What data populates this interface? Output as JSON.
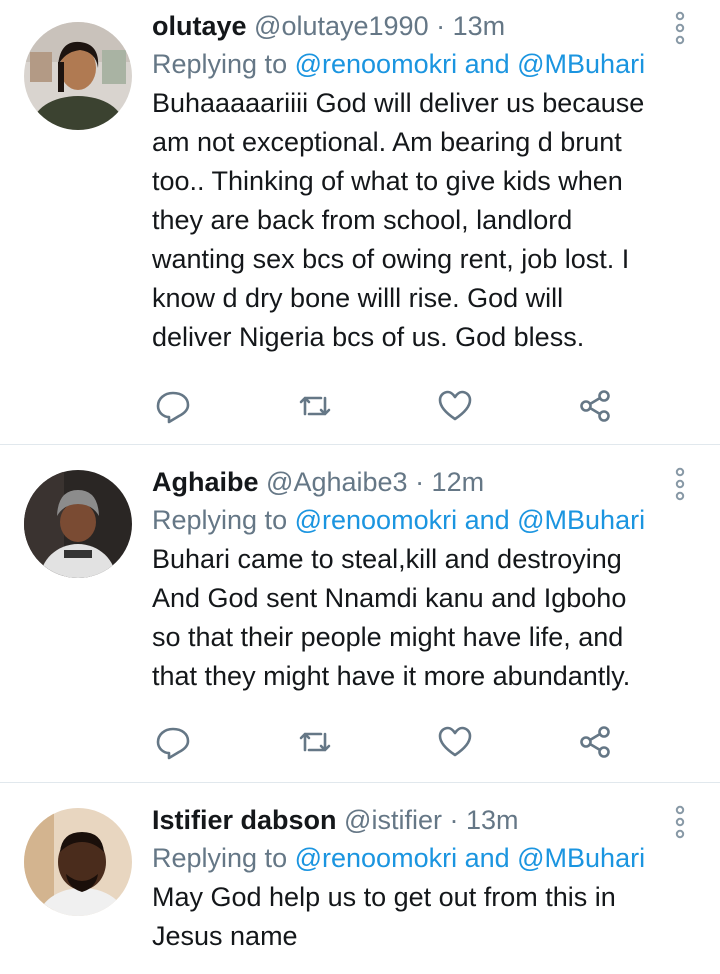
{
  "tweets": [
    {
      "name": "olutaye",
      "handle": "@olutaye1990",
      "time": "· 13m",
      "replying_prefix": "Replying to",
      "replying_to": "@renoomokri and @MBuhari",
      "lines": [
        "Buhaaaaariiii God will deliver us because",
        "am not exceptional. Am bearing d brunt",
        "too.. Thinking of what to give kids when",
        "they are back from school, landlord",
        "wanting sex bcs of owing rent, job lost. I",
        "know d dry bone willl rise. God will",
        "deliver Nigeria bcs of us. God bless."
      ]
    },
    {
      "name": "Aghaibe",
      "handle": "@Aghaibe3",
      "time": "· 12m",
      "replying_prefix": "Replying to",
      "replying_to": "@renoomokri and @MBuhari",
      "lines": [
        "Buhari came to steal,kill and destroying",
        "And God sent Nnamdi kanu and Igboho",
        "so that their people might have life, and",
        "that they might have it more abundantly."
      ]
    },
    {
      "name": "Istifier dabson",
      "handle": "@istifier",
      "time": "· 13m",
      "replying_prefix": "Replying to",
      "replying_to": "@renoomokri and @MBuhari",
      "lines": [
        "May God help us to get out from this in",
        "Jesus name"
      ]
    }
  ],
  "colors": {
    "accent": "#1b95e0",
    "secondary_text": "#657786",
    "divider": "#e1e8ed"
  },
  "icons": [
    "more-icon",
    "reply-icon",
    "retweet-icon",
    "like-icon",
    "share-icon"
  ]
}
